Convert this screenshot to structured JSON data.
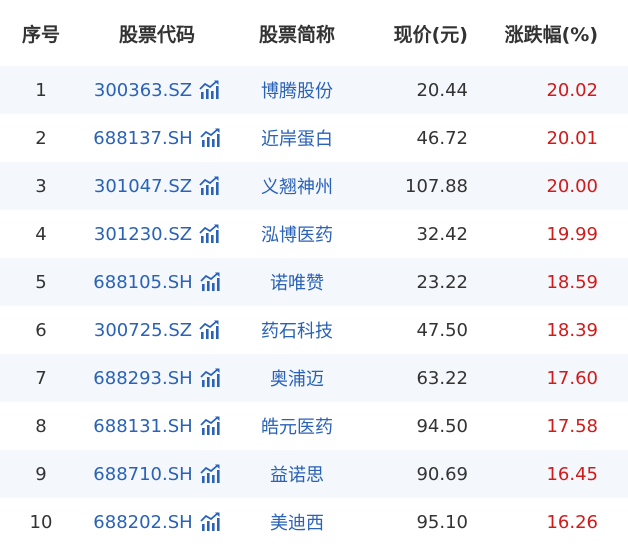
{
  "headers": {
    "index": "序号",
    "code": "股票代码",
    "name": "股票简称",
    "price": "现价(元)",
    "change": "涨跌幅(%)"
  },
  "colors": {
    "link": "#2a62b7",
    "up": "#d11a1a",
    "row_alt": "#f4f7fb"
  },
  "rows": [
    {
      "index": "1",
      "code": "300363.SZ",
      "name": "博腾股份",
      "price": "20.44",
      "change": "20.02"
    },
    {
      "index": "2",
      "code": "688137.SH",
      "name": "近岸蛋白",
      "price": "46.72",
      "change": "20.01"
    },
    {
      "index": "3",
      "code": "301047.SZ",
      "name": "义翘神州",
      "price": "107.88",
      "change": "20.00"
    },
    {
      "index": "4",
      "code": "301230.SZ",
      "name": "泓博医药",
      "price": "32.42",
      "change": "19.99"
    },
    {
      "index": "5",
      "code": "688105.SH",
      "name": "诺唯赞",
      "price": "23.22",
      "change": "18.59"
    },
    {
      "index": "6",
      "code": "300725.SZ",
      "name": "药石科技",
      "price": "47.50",
      "change": "18.39"
    },
    {
      "index": "7",
      "code": "688293.SH",
      "name": "奥浦迈",
      "price": "63.22",
      "change": "17.60"
    },
    {
      "index": "8",
      "code": "688131.SH",
      "name": "皓元医药",
      "price": "94.50",
      "change": "17.58"
    },
    {
      "index": "9",
      "code": "688710.SH",
      "name": "益诺思",
      "price": "90.69",
      "change": "16.45"
    },
    {
      "index": "10",
      "code": "688202.SH",
      "name": "美迪西",
      "price": "95.10",
      "change": "16.26"
    }
  ]
}
